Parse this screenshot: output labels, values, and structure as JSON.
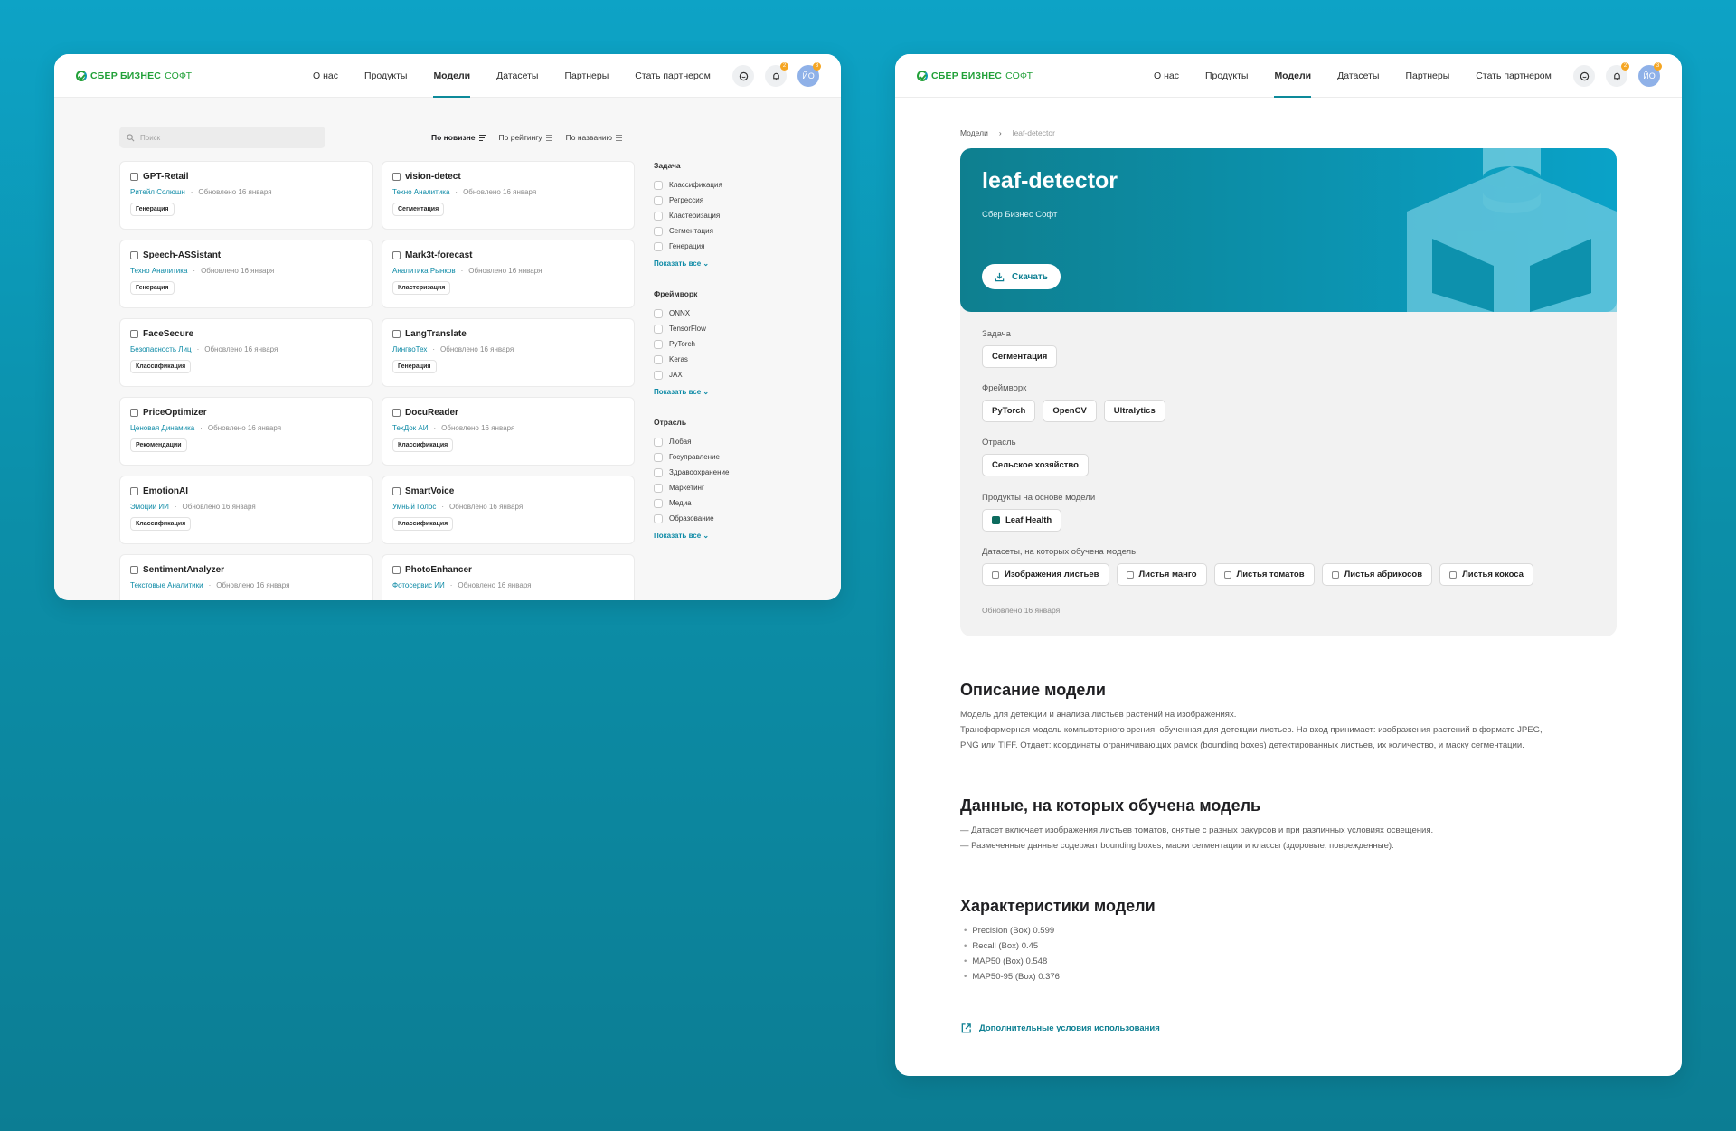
{
  "brand": {
    "name_bold": "СБЕР БИЗНЕС",
    "name_light": "СОФТ"
  },
  "nav": [
    "О нас",
    "Продукты",
    "Модели",
    "Датасеты",
    "Партнеры",
    "Стать партнером"
  ],
  "nav_active": "Модели",
  "header": {
    "bell_count": "2",
    "avatar_initials": "ЙО",
    "avatar_count": "3"
  },
  "catalog": {
    "search_placeholder": "Поиск",
    "sort": [
      "По новизне",
      "По рейтингу",
      "По названию"
    ],
    "cards": [
      {
        "title": "GPT-Retail",
        "company": "Ритейл Солюшн",
        "updated": "Обновлено 16 января",
        "tag": "Генерация"
      },
      {
        "title": "vision-detect",
        "company": "Техно Аналитика",
        "updated": "Обновлено 16 января",
        "tag": "Сегментация"
      },
      {
        "title": "Speech-ASSistant",
        "company": "Техно Аналитика",
        "updated": "Обновлено 16 января",
        "tag": "Генерация"
      },
      {
        "title": "Mark3t-forecast",
        "company": "Аналитика Рынков",
        "updated": "Обновлено 16 января",
        "tag": "Кластеризация"
      },
      {
        "title": "FaceSecure",
        "company": "Безопасность Лиц",
        "updated": "Обновлено 16 января",
        "tag": "Классификация"
      },
      {
        "title": "LangTranslate",
        "company": "ЛингвоТех",
        "updated": "Обновлено 16 января",
        "tag": "Генерация"
      },
      {
        "title": "PriceOptimizer",
        "company": "Ценовая Динамика",
        "updated": "Обновлено 16 января",
        "tag": "Рекомендации"
      },
      {
        "title": "DocuReader",
        "company": "ТехДок АИ",
        "updated": "Обновлено 16 января",
        "tag": "Классификация"
      },
      {
        "title": "EmotionAI",
        "company": "Эмоции ИИ",
        "updated": "Обновлено 16 января",
        "tag": "Классификация"
      },
      {
        "title": "SmartVoice",
        "company": "Умный Голос",
        "updated": "Обновлено 16 января",
        "tag": "Классификация"
      },
      {
        "title": "SentimentAnalyzer",
        "company": "Текстовые Аналитики",
        "updated": "Обновлено 16 января",
        "tag": ""
      },
      {
        "title": "PhotoEnhancer",
        "company": "Фотосервис ИИ",
        "updated": "Обновлено 16 января",
        "tag": ""
      }
    ],
    "filters": [
      {
        "title": "Задача",
        "options": [
          "Классификация",
          "Регрессия",
          "Кластеризация",
          "Сегментация",
          "Генерация"
        ]
      },
      {
        "title": "Фреймворк",
        "options": [
          "ONNX",
          "TensorFlow",
          "PyTorch",
          "Keras",
          "JAX"
        ]
      },
      {
        "title": "Отрасль",
        "options": [
          "Любая",
          "Госуправление",
          "Здравоохранение",
          "Маркетинг",
          "Медиа",
          "Образование"
        ]
      }
    ],
    "show_all": "Показать все"
  },
  "detail": {
    "breadcrumb": [
      "Модели",
      "leaf-detector"
    ],
    "title": "leaf-detector",
    "subtitle": "Сбер Бизнес Софт",
    "download": "Скачать",
    "task_label": "Задача",
    "task": [
      "Сегментация"
    ],
    "framework_label": "Фреймворк",
    "frameworks": [
      "PyTorch",
      "OpenCV",
      "Ultralytics"
    ],
    "industry_label": "Отрасль",
    "industry": [
      "Сельское хозяйство"
    ],
    "products_label": "Продукты на основе модели",
    "products": [
      "Leaf Health"
    ],
    "datasets_label": "Датасеты, на которых обучена модель",
    "datasets": [
      "Изображения листьев",
      "Листья манго",
      "Листья томатов",
      "Листья абрикосов",
      "Листья кокоса"
    ],
    "updated": "Обновлено 16 января",
    "desc_title": "Описание модели",
    "desc_lines": [
      "Модель для детекции и анализа листьев растений на изображениях.",
      "Трансформерная модель компьютерного зрения, обученная для детекции листьев. На вход принимает: изображения растений в формате JPEG,",
      "PNG или TIFF. Отдает: координаты ограничивающих рамок (bounding boxes) детектированных листьев, их количество, и маску сегментации."
    ],
    "data_title": "Данные, на которых обучена модель",
    "data_lines": [
      "— Датасет включает изображения листьев томатов, снятые с разных ракурсов и при различных условиях освещения.",
      "— Размеченные данные содержат bounding boxes, маски сегментации и классы (здоровые, поврежденные)."
    ],
    "metrics_title": "Характеристики модели",
    "metrics": [
      "Precision (Box) 0.599",
      "Recall (Box) 0.45",
      "MAP50 (Box) 0.548",
      "MAP50-95 (Box) 0.376"
    ],
    "extra_link": "Дополнительные условия использования"
  },
  "colors": {
    "accent": "#0d8aa6",
    "brand_green": "#21a038",
    "badge": "#f5a623",
    "avatar": "#8fb1e8"
  }
}
